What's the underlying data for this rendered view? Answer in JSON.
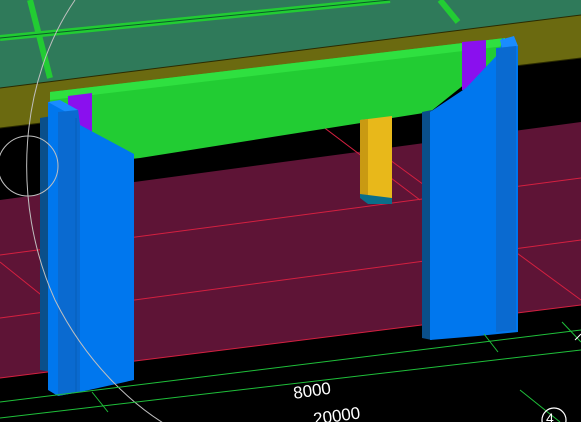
{
  "viewport": {
    "dimensions": {
      "span_label": "8000",
      "total_label": "20000"
    },
    "grid_bubble": {
      "label": "4"
    }
  },
  "colors": {
    "background": "#000000",
    "floor": "#5e1436",
    "floor_grid": "#d42040",
    "slab_top": "#2f7a5a",
    "slab_edge": "#6b6a10",
    "beam": "#22cc33",
    "column_blue": "#0077ee",
    "column_dark": "#0a4f8a",
    "column_purple": "#8a10ee",
    "post_yellow": "#e8b81a",
    "dimension_lines": "#1fbf3a",
    "orbit_circle": "#bfbfbf"
  },
  "icons": [
    "view-orbit-circle-icon",
    "grid-bubble-icon"
  ]
}
